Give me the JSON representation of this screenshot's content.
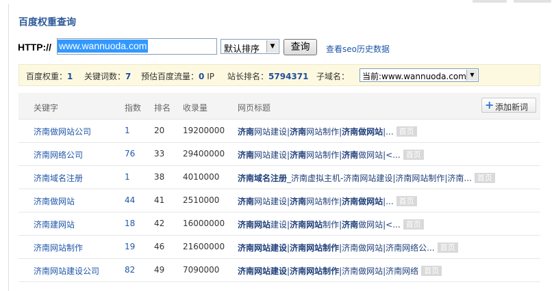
{
  "panel_title": "百度权重查询",
  "query": {
    "http_label": "HTTP://",
    "url_value": "www.wannuoda.com",
    "sort_selected": "默认排序",
    "query_button": "查询",
    "seo_history_link": "查看seo历史数据"
  },
  "info_bar": {
    "weight_label": "百度权重：",
    "weight_value": "1",
    "keywords_label": "关键词数：",
    "keywords_value": "7",
    "traffic_label": "预估百度流量：",
    "traffic_value": "0",
    "traffic_unit": "IP",
    "rank_label": "站长排名：",
    "rank_value": "5794371",
    "subdomain_label": "子域名：",
    "subdomain_selected": "当前:www.wannuoda.com"
  },
  "table": {
    "headers": {
      "keyword": "关键字",
      "index": "指数",
      "rank": "排名",
      "included": "收录量",
      "page_title": "网页标题"
    },
    "add_button": "添加新词",
    "home_tag": "首页",
    "rows": [
      {
        "keyword": "济南做网站公司",
        "index": "1",
        "rank": "20",
        "included": "19200000",
        "title": [
          {
            "t": "济南",
            "b": true
          },
          {
            "t": "网站建设|",
            "b": false
          },
          {
            "t": "济南",
            "b": true
          },
          {
            "t": "网站制作|",
            "b": false
          },
          {
            "t": "济南做网站",
            "b": true
          },
          {
            "t": "|...",
            "b": false
          }
        ]
      },
      {
        "keyword": "济南网络公司",
        "index": "76",
        "rank": "33",
        "included": "29400000",
        "title": [
          {
            "t": "济南",
            "b": true
          },
          {
            "t": "网站建设|",
            "b": false
          },
          {
            "t": "济南",
            "b": true
          },
          {
            "t": "网站制作|",
            "b": false
          },
          {
            "t": "济南",
            "b": true
          },
          {
            "t": "做网站|<...",
            "b": false
          }
        ]
      },
      {
        "keyword": "济南域名注册",
        "index": "1",
        "rank": "38",
        "included": "4010000",
        "title": [
          {
            "t": "济南域名注册",
            "b": true
          },
          {
            "t": "_济南虚拟主机-济南网站建设|济南网站制作|济南...",
            "b": false
          }
        ]
      },
      {
        "keyword": "济南做网站",
        "index": "44",
        "rank": "41",
        "included": "2510000",
        "title": [
          {
            "t": "济南",
            "b": true
          },
          {
            "t": "网站建设|",
            "b": false
          },
          {
            "t": "济南",
            "b": true
          },
          {
            "t": "网站制作|",
            "b": false
          },
          {
            "t": "济南做网站",
            "b": true
          },
          {
            "t": "|...",
            "b": false
          }
        ]
      },
      {
        "keyword": "济南建网站",
        "index": "18",
        "rank": "42",
        "included": "16000000",
        "title": [
          {
            "t": "济南网站",
            "b": true
          },
          {
            "t": "建设|",
            "b": false
          },
          {
            "t": "济南网站",
            "b": true
          },
          {
            "t": "制作|",
            "b": false
          },
          {
            "t": "济南",
            "b": true
          },
          {
            "t": "做网站|<...",
            "b": false
          }
        ]
      },
      {
        "keyword": "济南网站制作",
        "index": "19",
        "rank": "46",
        "included": "21600000",
        "title": [
          {
            "t": "济南网站建设",
            "b": true
          },
          {
            "t": "|",
            "b": false
          },
          {
            "t": "济南网站制作",
            "b": true
          },
          {
            "t": "|济南做网站|济南网络公...",
            "b": false
          }
        ]
      },
      {
        "keyword": "济南网站建设公司",
        "index": "82",
        "rank": "49",
        "included": "7090000",
        "title": [
          {
            "t": "济南网站建设",
            "b": true
          },
          {
            "t": "|",
            "b": false
          },
          {
            "t": "济南网站制作",
            "b": true
          },
          {
            "t": "|济南做网站|济南网络",
            "b": false
          }
        ]
      }
    ]
  },
  "colors": {
    "accent_blue": "#1f56a8",
    "title_blue": "#2d5a9a",
    "info_bar_bg": "#fdf9e0",
    "header_bg": "#f4f4f4",
    "home_tag_bg": "#d9d9d9"
  }
}
